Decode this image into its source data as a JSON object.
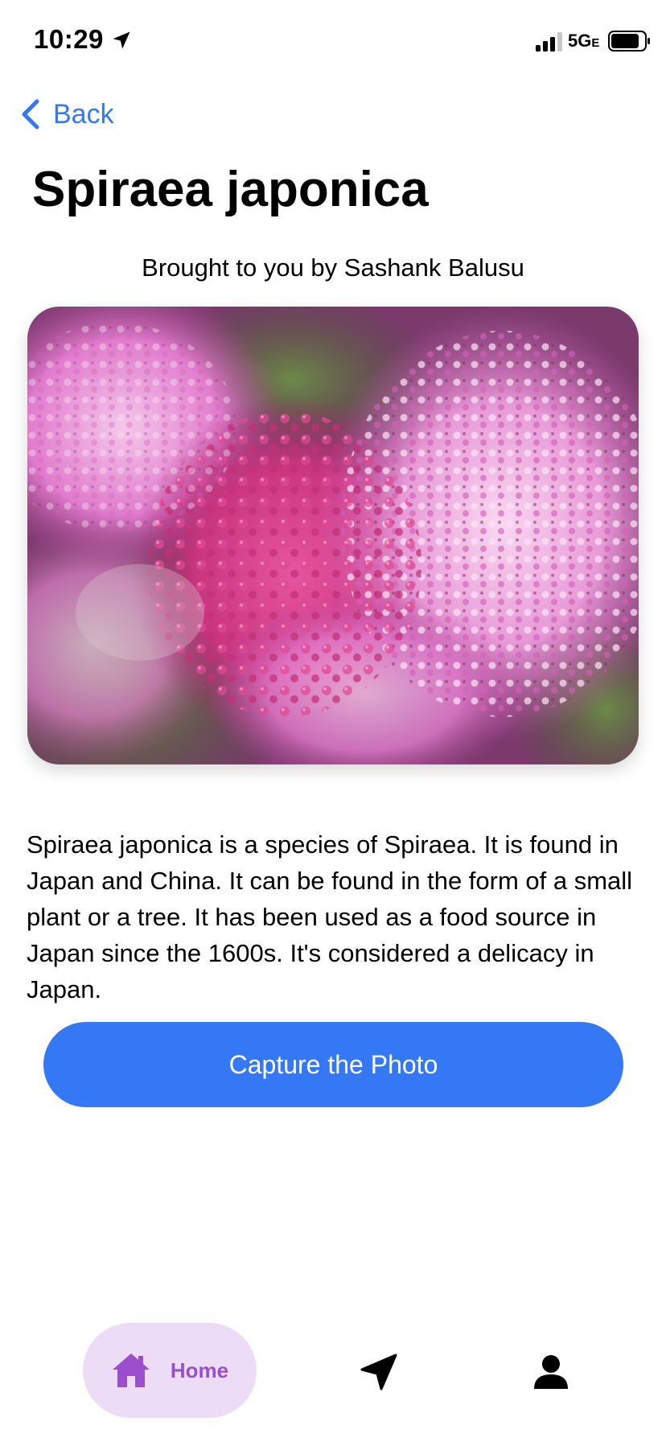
{
  "status_bar": {
    "time": "10:29",
    "network": "5G",
    "network_suffix": "E"
  },
  "nav": {
    "back_label": "Back"
  },
  "plant": {
    "title": "Spiraea japonica",
    "credit": "Brought to you by Sashank Balusu",
    "description": "Spiraea japonica is a species of Spiraea. It is found in Japan and China. It can be found in the form of a small plant or a tree. It has been used as a food source in Japan since the 1600s. It's considered a delicacy in Japan."
  },
  "actions": {
    "capture_label": "Capture the Photo"
  },
  "tab_bar": {
    "tabs": [
      {
        "label": "Home",
        "icon": "home-icon",
        "active": true
      },
      {
        "label": "",
        "icon": "navigation-arrow-icon",
        "active": false
      },
      {
        "label": "",
        "icon": "person-icon",
        "active": false
      }
    ]
  },
  "colors": {
    "accent": "#3478f6",
    "tab_active_bg": "#ecdcf6",
    "tab_active_fg": "#9b4fcc"
  }
}
